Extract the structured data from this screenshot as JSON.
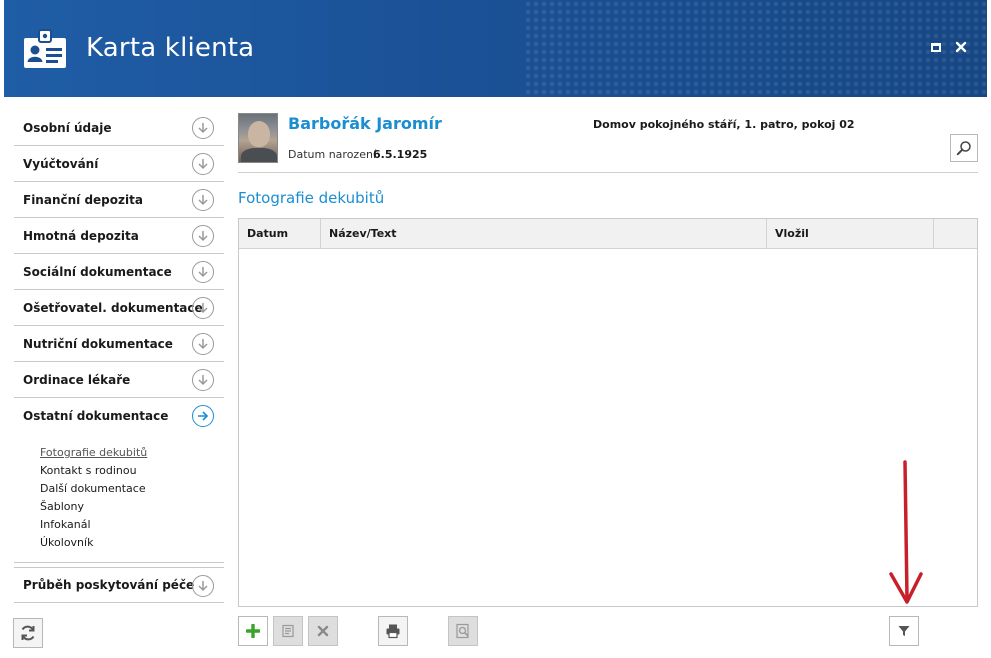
{
  "header": {
    "title": "Karta klienta"
  },
  "sidebar": {
    "items": [
      {
        "label": "Osobní údaje"
      },
      {
        "label": "Vyúčtování"
      },
      {
        "label": "Finanční depozita"
      },
      {
        "label": "Hmotná depozita"
      },
      {
        "label": "Sociální dokumentace"
      },
      {
        "label": "Ošetřovatel. dokumentace"
      },
      {
        "label": "Nutriční dokumentace"
      },
      {
        "label": "Ordinace lékaře"
      },
      {
        "label": "Ostatní dokumentace"
      }
    ],
    "subitems": [
      {
        "label": "Fotografie dekubitů"
      },
      {
        "label": "Kontakt s rodinou"
      },
      {
        "label": "Další dokumentace"
      },
      {
        "label": "Šablony"
      },
      {
        "label": "Infokanál"
      },
      {
        "label": "Úkolovník"
      }
    ],
    "last_item": {
      "label": "Průběh poskytování péče"
    }
  },
  "patient": {
    "name": "Barbořák Jaromír",
    "dob_label": "Datum narození:",
    "dob_value": "6.5.1925",
    "location": "Domov pokojného stáří, 1. patro, pokoj 02"
  },
  "section": {
    "title": "Fotografie dekubitů"
  },
  "table": {
    "columns": [
      "Datum",
      "Název/Text",
      "Vložil",
      ""
    ],
    "rows": []
  },
  "toolbar": {
    "add": "add-icon",
    "edit": "edit-icon",
    "delete": "delete-icon",
    "print": "print-icon",
    "preview": "preview-icon",
    "filter": "filter-icon"
  },
  "colors": {
    "header_bg": "#1a4f93",
    "accent": "#1b8ed1",
    "annotation": "#c8202a"
  }
}
